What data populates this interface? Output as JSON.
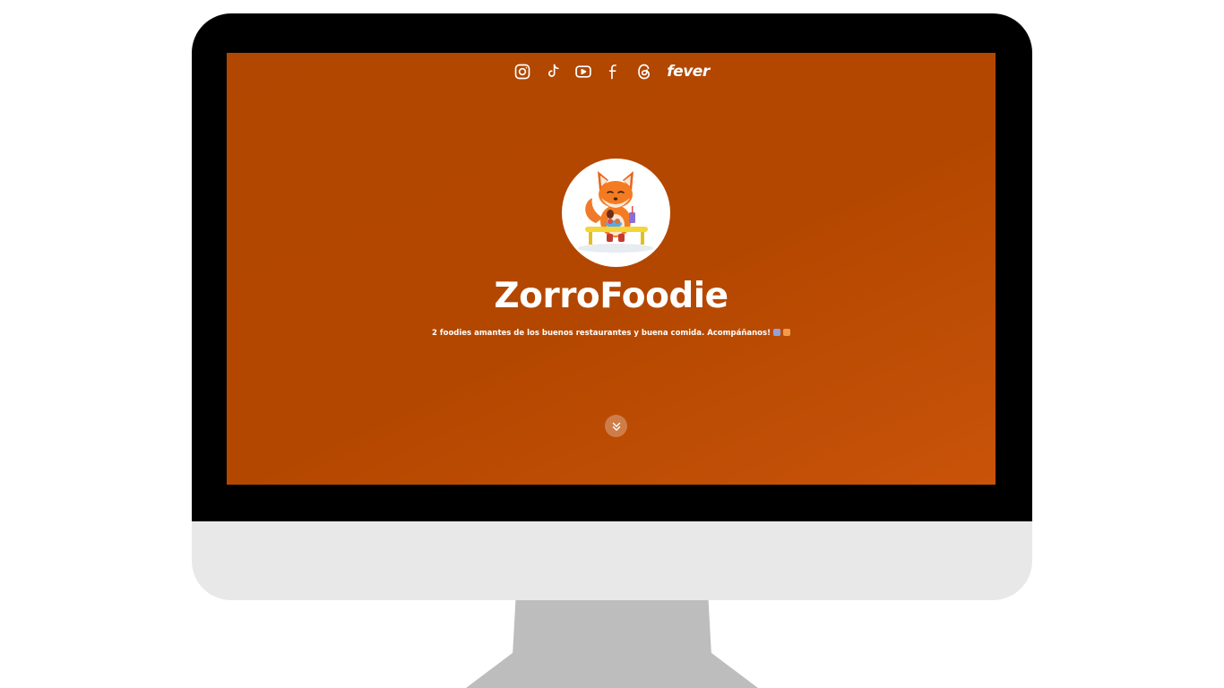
{
  "profile": {
    "name": "ZorroFoodie",
    "tagline": "2 foodies amantes de los buenos restaurantes y buena comida. Acompáñanos!",
    "tagline_emojis": [
      "fork-knife-emoji",
      "fox-emoji"
    ]
  },
  "social": {
    "icons": [
      "instagram-icon",
      "tiktok-icon",
      "youtube-icon",
      "facebook-icon",
      "threads-icon"
    ],
    "fever_label": "fever"
  },
  "scroll": {
    "icon": "chevrons-down-icon"
  },
  "colors": {
    "background": "#b44700",
    "background_end": "#c95309",
    "text": "#ffffff",
    "bezel": "#000000",
    "chin": "#e8e8e8",
    "stand": "#bdbdbd"
  }
}
